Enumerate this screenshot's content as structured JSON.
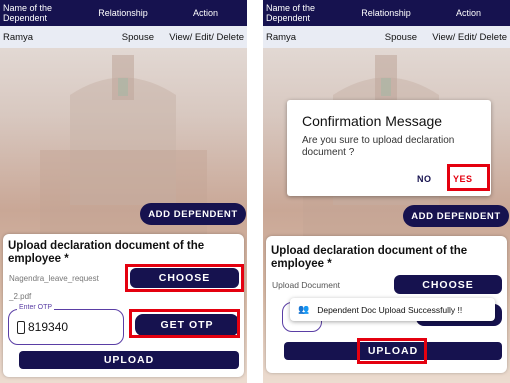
{
  "table": {
    "headers": [
      "Name of the Dependent",
      "Relationship",
      "Action"
    ],
    "row": {
      "name": "Ramya",
      "relationship": "Spouse",
      "action": "View/ Edit/ Delete"
    }
  },
  "add_dependent_label": "ADD DEPENDENT",
  "upload_card": {
    "title": "Upload declaration document of the employee *",
    "left": {
      "file_name_line1": "Nagendra_leave_request",
      "file_name_line2": "_2.pdf",
      "choose_label": "CHOOSE",
      "otp_legend": "Enter OTP",
      "otp_value": "819340",
      "get_otp_label": "GET OTP",
      "upload_label": "UPLOAD"
    },
    "right": {
      "upload_document_label": "Upload Document",
      "choose_label": "CHOOSE",
      "upload_label": "UPLOAD"
    }
  },
  "dialog": {
    "title": "Confirmation Message",
    "message": "Are you sure to upload declaration document ?",
    "no_label": "NO",
    "yes_label": "YES"
  },
  "toast": {
    "message": "Dependent Doc Upload Successfully !!"
  },
  "colors": {
    "navy": "#16124f",
    "highlight_red": "#e4000f",
    "otp_border": "#5a3ea5"
  }
}
